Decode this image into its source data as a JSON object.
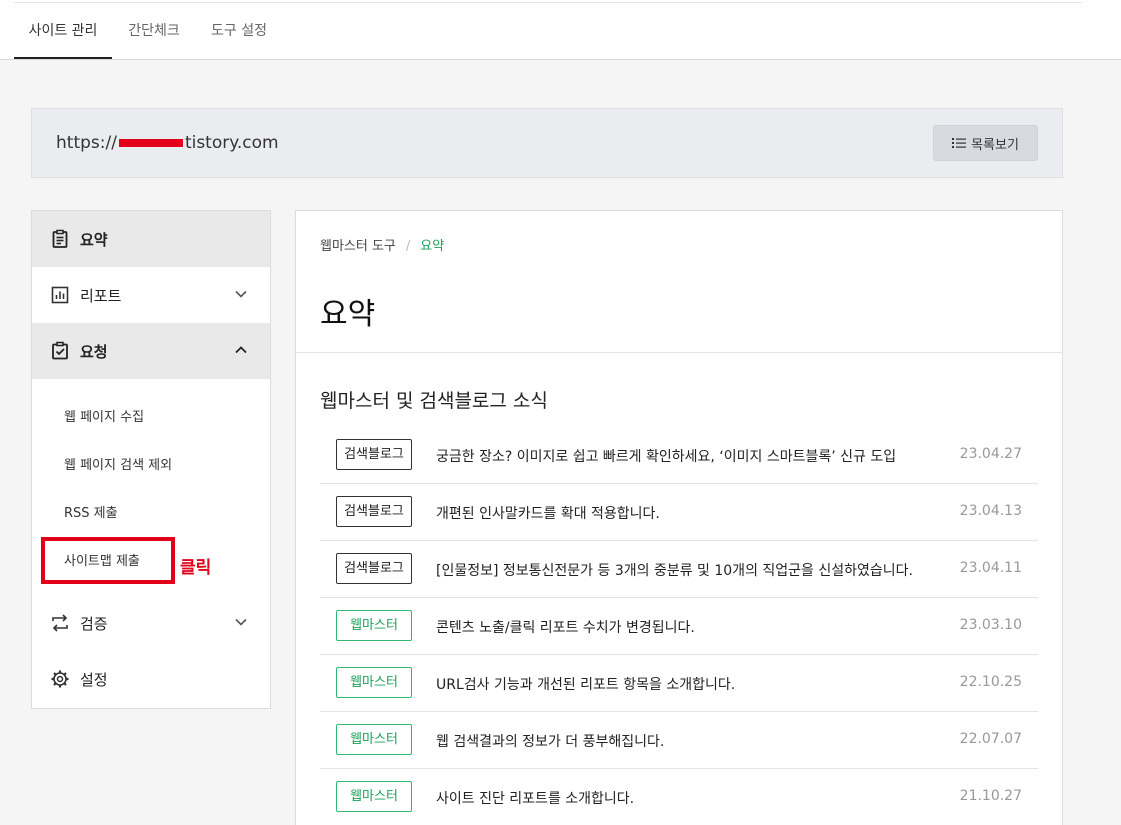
{
  "tabs": [
    {
      "label": "사이트 관리"
    },
    {
      "label": "간단체크"
    },
    {
      "label": "도구 설정"
    }
  ],
  "site": {
    "url_prefix": "https://",
    "url_suffix": "tistory.com",
    "list_button": "목록보기"
  },
  "sidebar": {
    "summary": "요약",
    "report": "리포트",
    "request": "요청",
    "sub_items": [
      "웹 페이지 수집",
      "웹 페이지 검색 제외",
      "RSS 제출",
      "사이트맵 제출"
    ],
    "verify": "검증",
    "settings": "설정"
  },
  "annotation": {
    "click_label": "클릭"
  },
  "main": {
    "breadcrumb_root": "웹마스터 도구",
    "breadcrumb_sep": "/",
    "breadcrumb_current": "요약",
    "title": "요약",
    "section_title": "웹마스터 및 검색블로그 소식"
  },
  "news": [
    {
      "badge": "검색블로그",
      "title": "궁금한 장소? 이미지로 쉽고 빠르게 확인하세요, ‘이미지 스마트블록’ 신규 도입",
      "date": "23.04.27"
    },
    {
      "badge": "검색블로그",
      "title": "개편된 인사말카드를 확대 적용합니다.",
      "date": "23.04.13"
    },
    {
      "badge": "검색블로그",
      "title": "[인물정보] 정보통신전문가 등 3개의 중분류 및 10개의 직업군을 신설하였습니다.",
      "date": "23.04.11"
    },
    {
      "badge": "웹마스터",
      "title": "콘텐츠 노출/클릭 리포트 수치가 변경됩니다.",
      "date": "23.03.10"
    },
    {
      "badge": "웹마스터",
      "title": "URL검사 기능과 개선된 리포트 항목을 소개합니다.",
      "date": "22.10.25"
    },
    {
      "badge": "웹마스터",
      "title": "웹 검색결과의 정보가 더 풍부해집니다.",
      "date": "22.07.07"
    },
    {
      "badge": "웹마스터",
      "title": "사이트 진단 리포트를 소개합니다.",
      "date": "21.10.27"
    }
  ],
  "colors": {
    "accent_green": "#17a35a",
    "annotation_red": "#e2001a"
  }
}
